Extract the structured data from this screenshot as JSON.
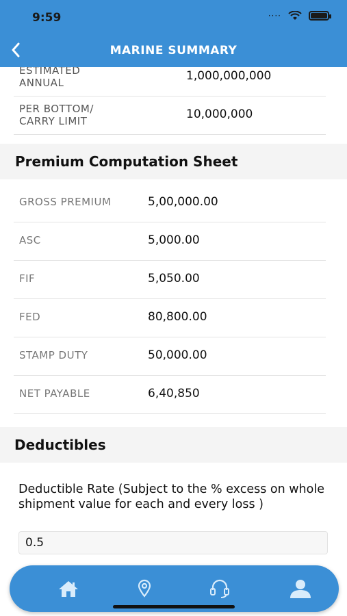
{
  "status_bar": {
    "time": "9:59"
  },
  "header": {
    "title": "MARINE SUMMARY"
  },
  "top_rows": [
    {
      "label_line1": "ESTIMATED",
      "label_line2": "ANNUAL",
      "value": "1,000,000,000"
    },
    {
      "label_line1": "PER BOTTOM/",
      "label_line2": "CARRY LIMIT",
      "value": "10,000,000"
    }
  ],
  "premium_section": {
    "title": "Premium Computation Sheet",
    "rows": [
      {
        "label": "GROSS PREMIUM",
        "value": "5,00,000.00"
      },
      {
        "label": "ASC",
        "value": "5,000.00"
      },
      {
        "label": "FIF",
        "value": "5,050.00"
      },
      {
        "label": "FED",
        "value": "80,800.00"
      },
      {
        "label": "STAMP DUTY",
        "value": "50,000.00"
      },
      {
        "label": "NET PAYABLE",
        "value": "6,40,850"
      }
    ]
  },
  "deductibles": {
    "title": "Deductibles",
    "rate_label": "Deductible Rate (Subject to the % excess on whole shipment value for each and every loss )",
    "rate_value": "0.5"
  },
  "bottom_nav": {
    "items": [
      "home-icon",
      "location-icon",
      "headset-icon",
      "profile-icon"
    ]
  },
  "colors": {
    "primary": "#3b8fd6",
    "section_bg": "#f4f4f4"
  }
}
